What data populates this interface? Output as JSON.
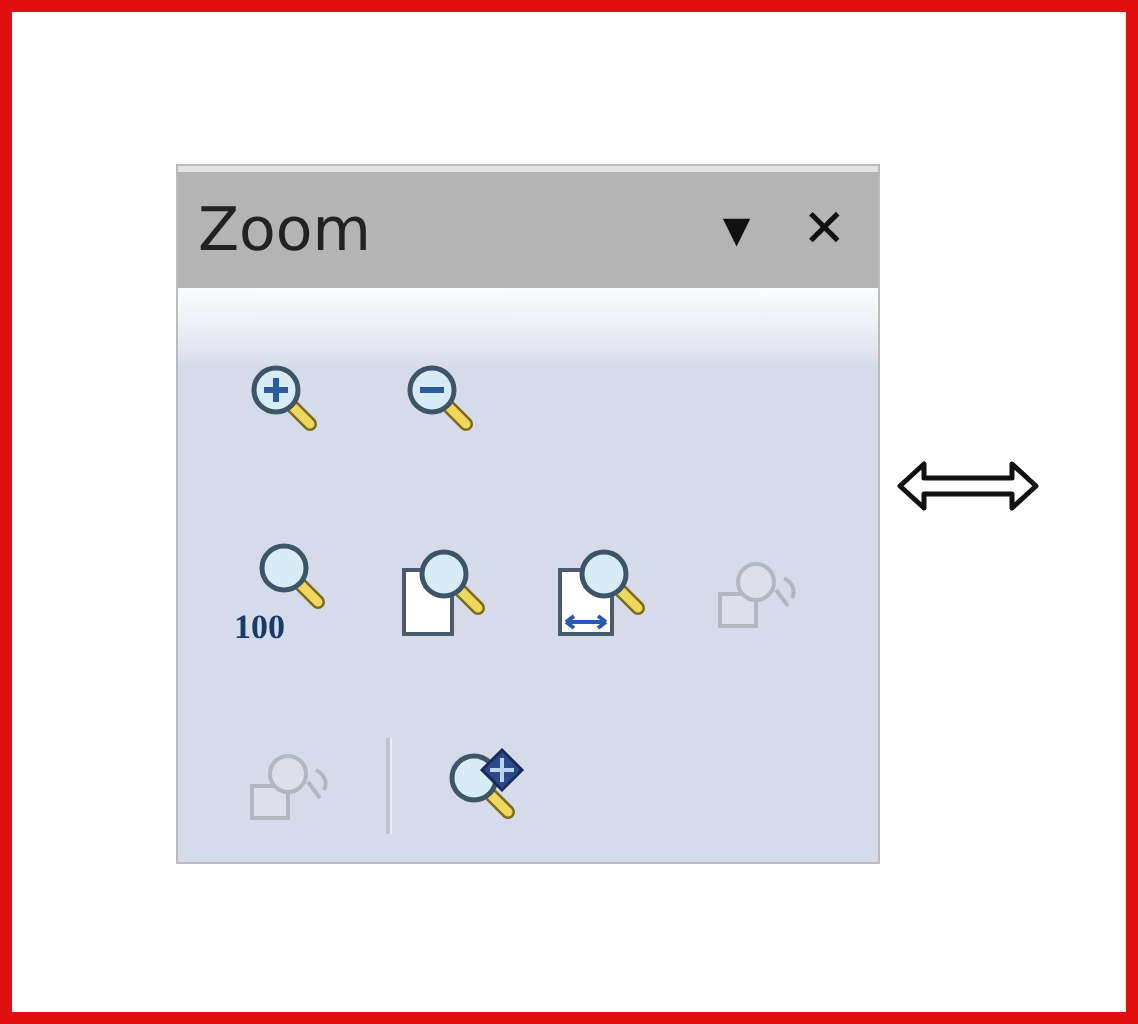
{
  "window": {
    "title": "Zoom"
  },
  "title_buttons": [
    {
      "kind": "menu",
      "glyph": "▼"
    },
    {
      "kind": "close",
      "glyph": "✕"
    }
  ],
  "rows": [
    [
      {
        "kind": "zoom-in",
        "disabled": false
      },
      {
        "kind": "zoom-out",
        "disabled": false
      }
    ],
    [
      {
        "kind": "zoom-100",
        "label": "100",
        "disabled": false
      },
      {
        "kind": "page",
        "disabled": false
      },
      {
        "kind": "page-width",
        "disabled": false
      },
      {
        "kind": "shapes",
        "disabled": true
      }
    ],
    [
      {
        "kind": "shapes",
        "disabled": true
      },
      {
        "kind": "separator"
      },
      {
        "kind": "pan",
        "disabled": false
      }
    ]
  ],
  "cursor": {
    "kind": "resize-horizontal"
  }
}
